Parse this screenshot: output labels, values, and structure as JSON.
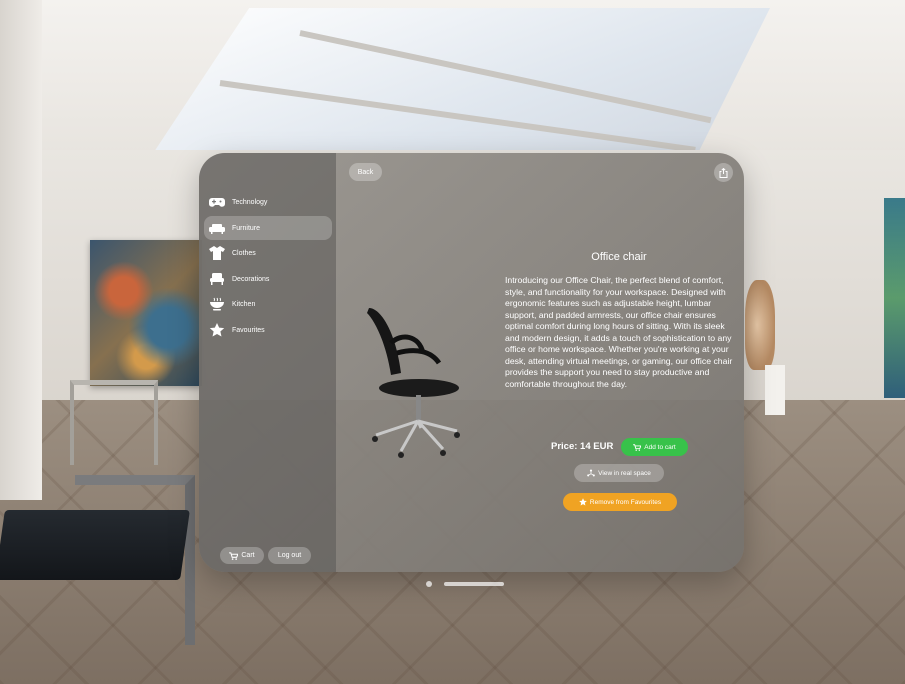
{
  "sidebar": {
    "items": [
      {
        "label": "Technology",
        "icon": "gamepad-icon"
      },
      {
        "label": "Furniture",
        "icon": "sofa-icon",
        "active": true
      },
      {
        "label": "Clothes",
        "icon": "shirt-icon"
      },
      {
        "label": "Decorations",
        "icon": "chair-icon"
      },
      {
        "label": "Kitchen",
        "icon": "bowl-icon"
      },
      {
        "label": "Favourites",
        "icon": "star-icon"
      }
    ],
    "cart_label": "Cart",
    "logout_label": "Log out"
  },
  "toolbar": {
    "back_label": "Back"
  },
  "product": {
    "title": "Office chair",
    "description": "Introducing our Office Chair, the perfect blend of comfort, style, and functionality for your workspace. Designed with ergonomic features such as adjustable height, lumbar support, and padded armrests, our office chair ensures optimal comfort during long hours of sitting. With its sleek and modern design, it adds a touch of sophistication to any office or home workspace. Whether you're working at your desk, attending virtual meetings, or gaming, our office chair provides the support you need to stay productive and comfortable throughout the day.",
    "price_label": "Price: 14 EUR",
    "add_to_cart_label": "Add to cart",
    "view_in_real_space_label": "View in real space",
    "remove_from_favourites_label": "Remove from Favourites"
  },
  "colors": {
    "add_to_cart": "#38c24a",
    "remove_favourites": "#f0a323"
  }
}
